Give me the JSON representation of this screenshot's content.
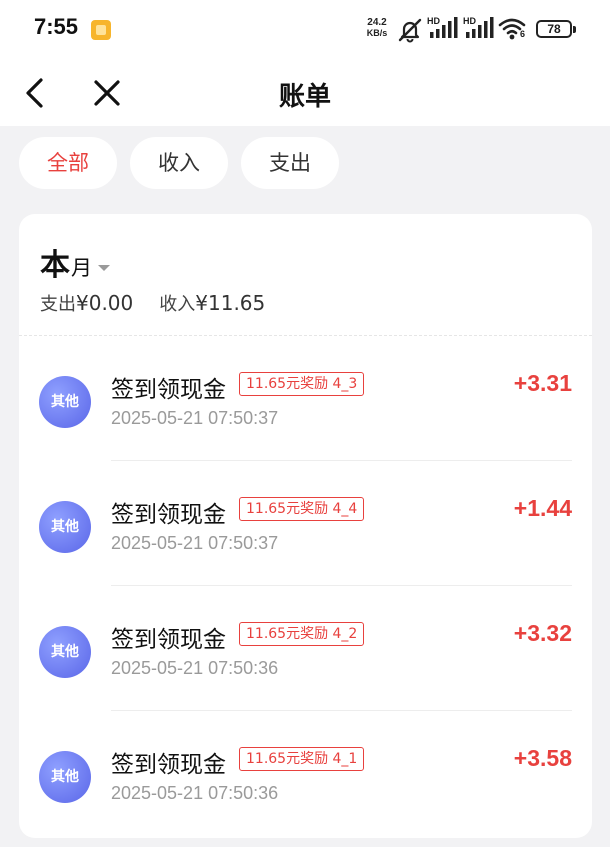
{
  "status_bar": {
    "time": "7:55",
    "net_speed_value": "24.2",
    "net_speed_unit": "KB/s",
    "battery": "78",
    "hd1": "HD",
    "hd2": "HD",
    "wifi_sub": "6"
  },
  "nav": {
    "title": "账单"
  },
  "tabs": [
    {
      "label": "全部",
      "active": true
    },
    {
      "label": "收入",
      "active": false
    },
    {
      "label": "支出",
      "active": false
    }
  ],
  "period": {
    "big": "本",
    "small": "月",
    "expense_label": "支出",
    "expense_value": "¥0.00",
    "income_label": "收入",
    "income_value": "¥11.65"
  },
  "transactions": [
    {
      "avatar": "其他",
      "title": "签到领现金",
      "tag": "11.65元奖励 4_3",
      "time": "2025-05-21 07:50:37",
      "amount": "+3.31"
    },
    {
      "avatar": "其他",
      "title": "签到领现金",
      "tag": "11.65元奖励 4_4",
      "time": "2025-05-21 07:50:37",
      "amount": "+1.44"
    },
    {
      "avatar": "其他",
      "title": "签到领现金",
      "tag": "11.65元奖励 4_2",
      "time": "2025-05-21 07:50:36",
      "amount": "+3.32"
    },
    {
      "avatar": "其他",
      "title": "签到领现金",
      "tag": "11.65元奖励 4_1",
      "time": "2025-05-21 07:50:36",
      "amount": "+3.58"
    }
  ],
  "colors": {
    "accent": "#e8413e",
    "avatar": "#6a74ee",
    "background": "#f2f2f4"
  }
}
